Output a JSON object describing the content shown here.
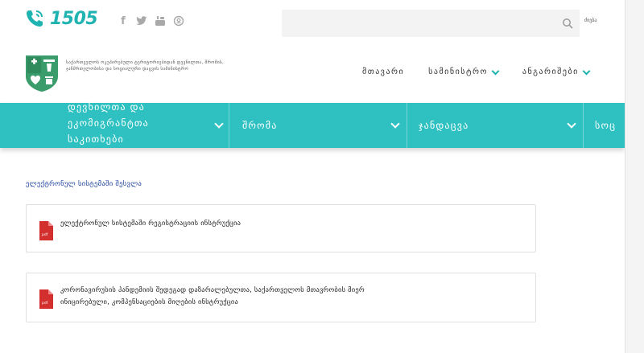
{
  "header": {
    "hotline_number": "1505",
    "social": [
      "f",
      "t",
      "youtube",
      "ok"
    ],
    "search": {
      "placeholder": "",
      "button_label": "ძიება"
    }
  },
  "ministry": {
    "name": "საქართველოს ოკუპირებული ტერიტორიებიდან დევნილთა, შრომის, ჯანმრთელობისა და სოციალური დაცვის სამინისტრო"
  },
  "topnav": {
    "items": [
      {
        "label": "მთავარი",
        "has_dropdown": false
      },
      {
        "label": "სამინისტრო",
        "has_dropdown": true
      },
      {
        "label": "ანგარიშები",
        "has_dropdown": true
      }
    ]
  },
  "categories": [
    {
      "label_line1": "დევნილთა და",
      "label_line2": "ეკომიგრანტთა",
      "label_line3": "საკითხები"
    },
    {
      "label_line1": "შრომა"
    },
    {
      "label_line1": "ჯანდაცვა"
    },
    {
      "label_line1": "სოც"
    }
  ],
  "content": {
    "section_title": "ელექტრონულ სისტემაში შესვლა",
    "documents": [
      {
        "title": "ელექტრონულ სისტემაში რეგისტრაციის ინსტრუქცია",
        "icon": "pdf-icon",
        "icon_text": "pdf"
      },
      {
        "title_line1": "კორონავირუსის პანდემიის შედეგად დაზარალებულთა, საქართველოს მთავრობის მიერ",
        "title_line2": "ინიცირებული, კომპენსაციების მიღების ინსტრუქცია",
        "icon": "pdf-icon",
        "icon_text": "pdf"
      }
    ]
  },
  "colors": {
    "brand_teal": "#2fc1c1",
    "hotline_teal": "#1fb3b1",
    "link_blue": "#1c3f9c",
    "pdf_red": "#d32f2f"
  }
}
